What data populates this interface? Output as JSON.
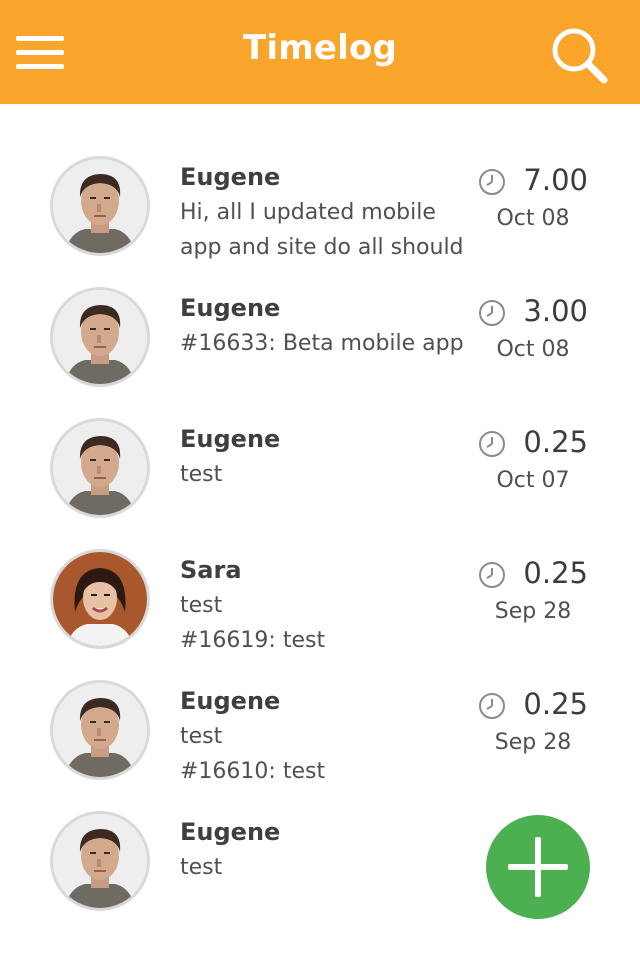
{
  "header": {
    "title": "Timelog",
    "menu_icon": "hamburger-menu-icon",
    "search_icon": "search-icon",
    "color": "#f9a42a"
  },
  "entries": [
    {
      "author": "Eugene",
      "avatar": "male-avatar-photo",
      "lines": [
        "Hi, all I updated mobile",
        "app and site do all should"
      ],
      "hours": "7.00",
      "date": "Oct 08"
    },
    {
      "author": "Eugene",
      "avatar": "male-avatar-photo",
      "lines": [
        "#16633: Beta mobile app"
      ],
      "hours": "3.00",
      "date": "Oct 08"
    },
    {
      "author": "Eugene",
      "avatar": "male-avatar-photo",
      "lines": [
        "test"
      ],
      "hours": "0.25",
      "date": "Oct 07"
    },
    {
      "author": "Sara",
      "avatar": "female-avatar-photo",
      "lines": [
        "test",
        "#16619: test"
      ],
      "hours": "0.25",
      "date": "Sep 28"
    },
    {
      "author": "Eugene",
      "avatar": "male-avatar-photo",
      "lines": [
        "test",
        "#16610: test"
      ],
      "hours": "0.25",
      "date": "Sep 28"
    },
    {
      "author": "Eugene",
      "avatar": "male-avatar-photo",
      "lines": [
        "test"
      ],
      "hours": "",
      "date": ""
    }
  ],
  "fab": {
    "icon": "plus-icon",
    "color": "#4caf50"
  },
  "clock_icon": "clock-icon"
}
